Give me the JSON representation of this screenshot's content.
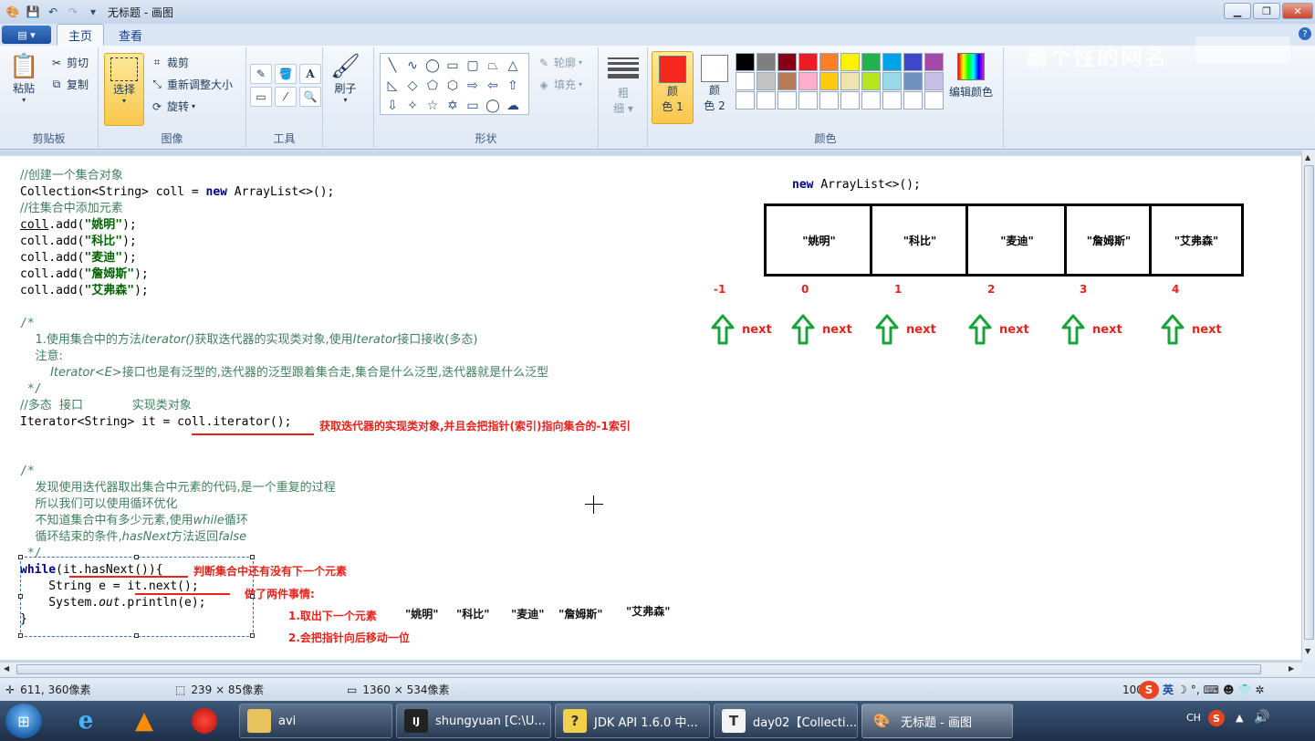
{
  "window": {
    "title": "无标题 - 画图"
  },
  "tabs": [
    {
      "label": "主页"
    },
    {
      "label": "查看"
    }
  ],
  "watermark": "最个性的网名",
  "ribbon": {
    "clipboard": {
      "label": "剪贴板",
      "paste": "粘贴",
      "cut": "剪切",
      "copy": "复制"
    },
    "image": {
      "label": "图像",
      "select": "选择",
      "crop": "裁剪",
      "resize": "重新调整大小",
      "rotate": "旋转"
    },
    "tools": {
      "label": "工具"
    },
    "brushes": {
      "label": "刷子"
    },
    "shapes": {
      "label": "形状",
      "outline": "轮廓",
      "fill": "填充"
    },
    "size": {
      "label1": "粗",
      "label2": "细"
    },
    "colors": {
      "label": "颜色",
      "color1": {
        "l1": "颜",
        "l2": "色 1",
        "hex": "#f5281d"
      },
      "color2": {
        "l1": "颜",
        "l2": "色 2",
        "hex": "#ffffff"
      },
      "edit": "编辑颜色",
      "palette": [
        "#000000",
        "#7f7f7f",
        "#880015",
        "#ed1c24",
        "#ff7f27",
        "#fff200",
        "#22b14c",
        "#00a2e8",
        "#3f48cc",
        "#a349a4",
        "#ffffff",
        "#c3c3c3",
        "#b97a57",
        "#ffaec9",
        "#ffc90e",
        "#efe4b0",
        "#b5e61d",
        "#99d9ea",
        "#7092be",
        "#c8bfe7",
        "#ffffff",
        "#ffffff",
        "#ffffff",
        "#ffffff",
        "#ffffff",
        "#ffffff",
        "#ffffff",
        "#ffffff",
        "#ffffff",
        "#ffffff"
      ]
    }
  },
  "canvas": {
    "diagram_title": "new ArrayList<>();",
    "cells": [
      "\"姚明\"",
      "\"科比\"",
      "\"麦迪\"",
      "\"詹姆斯\"",
      "\"艾弗森\""
    ],
    "indices": [
      "-1",
      "0",
      "1",
      "2",
      "3",
      "4"
    ],
    "next": "next",
    "ann_iterator": "获取迭代器的实现类对象,并且会把指针(索引)指向集合的-1索引",
    "ann_hasnext": "判断集合中还有没有下一个元素",
    "ann_next": "做了两件事情:",
    "ann_step1": "1.取出下一个元素",
    "ann_step2": "2.会把指针向后移动一位",
    "ann_names": [
      "\"姚明\"",
      "\"科比\"",
      "\"麦迪\"",
      "\"詹姆斯\"",
      "\"艾弗森\""
    ]
  },
  "status": {
    "cursor": "611, 360像素",
    "selection": "239 × 85像素",
    "size": "1360 × 534像素",
    "zoom": "100"
  },
  "taskbar": {
    "tasks": [
      {
        "label": "avi"
      },
      {
        "label": "shungyuan [C:\\U..."
      },
      {
        "label": "JDK API 1.6.0 中..."
      },
      {
        "label": "day02【Collecti..."
      },
      {
        "label": "无标题 - 画图"
      }
    ],
    "lang": "CH",
    "ime": "英"
  }
}
